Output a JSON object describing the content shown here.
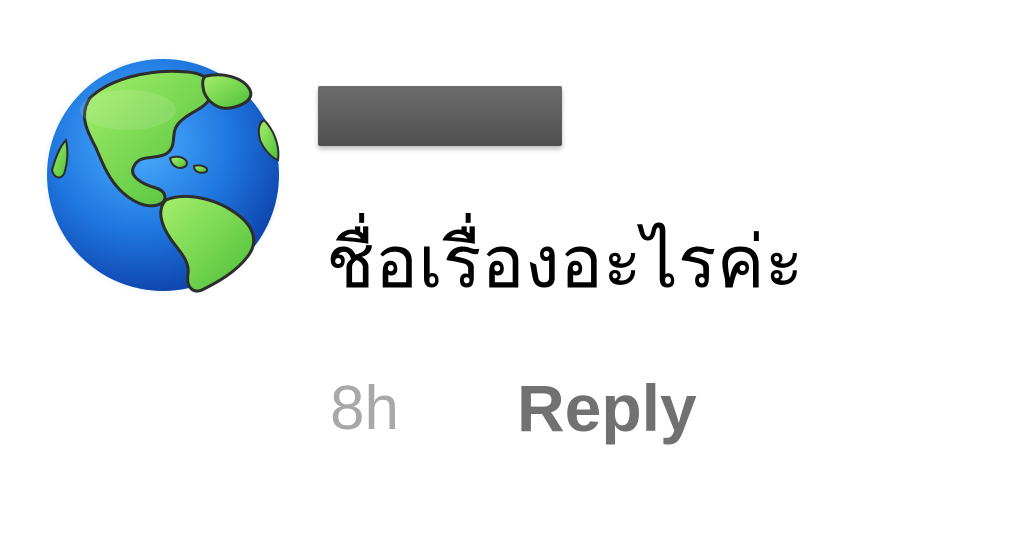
{
  "comment": {
    "avatar_icon": "earth-globe-americas-icon",
    "username_redacted": true,
    "text": "ชื่อเรื่องอะไรค่ะ",
    "timestamp": "8h",
    "reply_label": "Reply"
  },
  "colors": {
    "timestamp": "#a8a8a8",
    "reply": "#717171",
    "redaction_bar": "#5e5e5e",
    "ocean": "#2a7fe0",
    "land": "#7ed957"
  }
}
